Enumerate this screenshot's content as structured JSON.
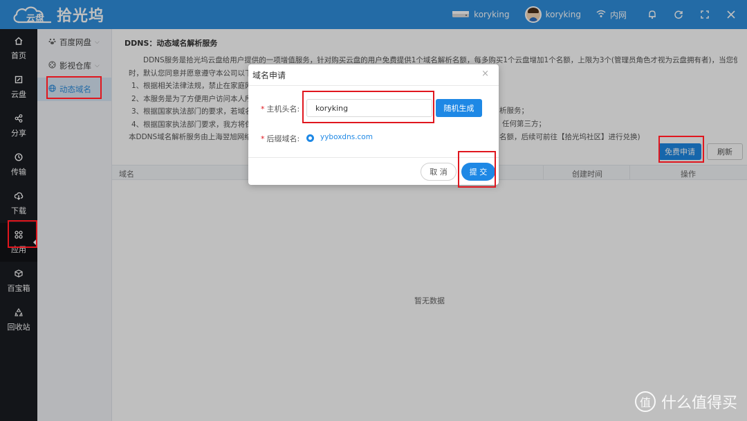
{
  "app": {
    "logo_small": "云盘",
    "name": "拾光坞"
  },
  "topbar": {
    "device_name": "koryking",
    "user_name": "koryking",
    "network": "内网"
  },
  "nav": {
    "items": [
      {
        "label": "首页"
      },
      {
        "label": "云盘"
      },
      {
        "label": "分享"
      },
      {
        "label": "传输"
      },
      {
        "label": "下载"
      },
      {
        "label": "应用"
      },
      {
        "label": "百宝箱"
      },
      {
        "label": "回收站"
      }
    ]
  },
  "submenu": {
    "items": [
      {
        "label": "百度网盘"
      },
      {
        "label": "影视仓库"
      },
      {
        "label": "动态域名"
      }
    ]
  },
  "content": {
    "title": "DDNS：动态域名解析服务",
    "desc": [
      "DDNS服务是拾光坞云盘给用户提供的一项增值服务，针对购买云盘的用户免费提供1个域名解析名额，每多购买1个云盘增加1个名额，上限为3个(管理员角色才视为云盘拥有者)，当您使用本服务",
      "时，默认您同意并愿意遵守本公司以下管",
      "1、根据相关法律法规，禁止在家庭网络",
      "2、本服务是为了方便用户访问本人所",
      "3、根据国家执法部门的要求，若域名",
      "4、根据国家执法部门要求，我方将保",
      "本DDNS域名解析服务由上海翌旭网络"
    ],
    "desc_right": [
      "析服务；",
      "任何第三方；",
      "名额，后续可前往【拾光坞社区】进行兑换)"
    ],
    "apply_label": "免费申请",
    "refresh_label": "刷新",
    "table_headers": [
      "域名",
      "创建时间",
      "操作"
    ],
    "empty_text": "暂无数据"
  },
  "dialog": {
    "title": "域名申请",
    "close": "×",
    "host_label": "主机头名:",
    "host_value": "koryking",
    "random_label": "随机生成",
    "suffix_label": "后缀域名:",
    "suffix_value": "yyboxdns.com",
    "cancel_label": "取 消",
    "submit_label": "提 交"
  },
  "watermark": {
    "text": "什么值得买",
    "glyph": "值"
  },
  "colors": {
    "primary": "#2f8fde",
    "button_blue": "#1e88e5",
    "nav_bg": "#1a1c22",
    "highlight": "#e0161e"
  }
}
